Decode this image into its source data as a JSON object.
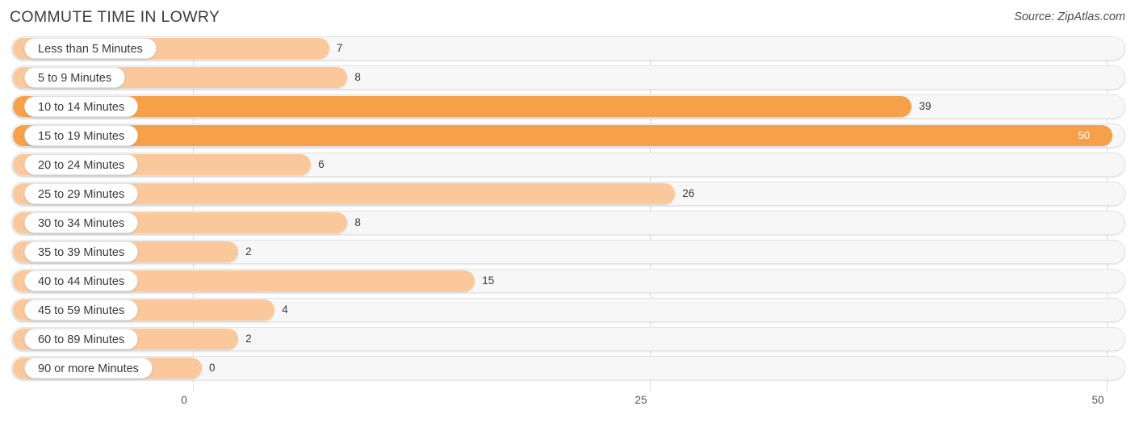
{
  "header": {
    "title": "COMMUTE TIME IN LOWRY",
    "source": "Source: ZipAtlas.com"
  },
  "chart_data": {
    "type": "bar",
    "orientation": "horizontal",
    "title": "COMMUTE TIME IN LOWRY",
    "xlabel": "",
    "ylabel": "",
    "xlim": [
      0,
      50
    ],
    "grid": true,
    "legend": "none",
    "ticks": [
      {
        "label": "0",
        "value": 0
      },
      {
        "label": "25",
        "value": 25
      },
      {
        "label": "50",
        "value": 50
      }
    ],
    "categories": [
      "Less than 5 Minutes",
      "5 to 9 Minutes",
      "10 to 14 Minutes",
      "15 to 19 Minutes",
      "20 to 24 Minutes",
      "25 to 29 Minutes",
      "30 to 34 Minutes",
      "35 to 39 Minutes",
      "40 to 44 Minutes",
      "45 to 59 Minutes",
      "60 to 89 Minutes",
      "90 or more Minutes"
    ],
    "values": [
      7,
      8,
      39,
      50,
      6,
      26,
      8,
      2,
      15,
      4,
      2,
      0
    ],
    "value_labels": [
      "7",
      "8",
      "39",
      "50",
      "6",
      "26",
      "8",
      "2",
      "15",
      "4",
      "2",
      "0"
    ],
    "colors": {
      "bar_light": "#fac89a",
      "bar_strong": "#f6a04a",
      "track": "#f7f7f7",
      "gridline": "#dcdcdc",
      "text": "#3a3a3a"
    }
  }
}
